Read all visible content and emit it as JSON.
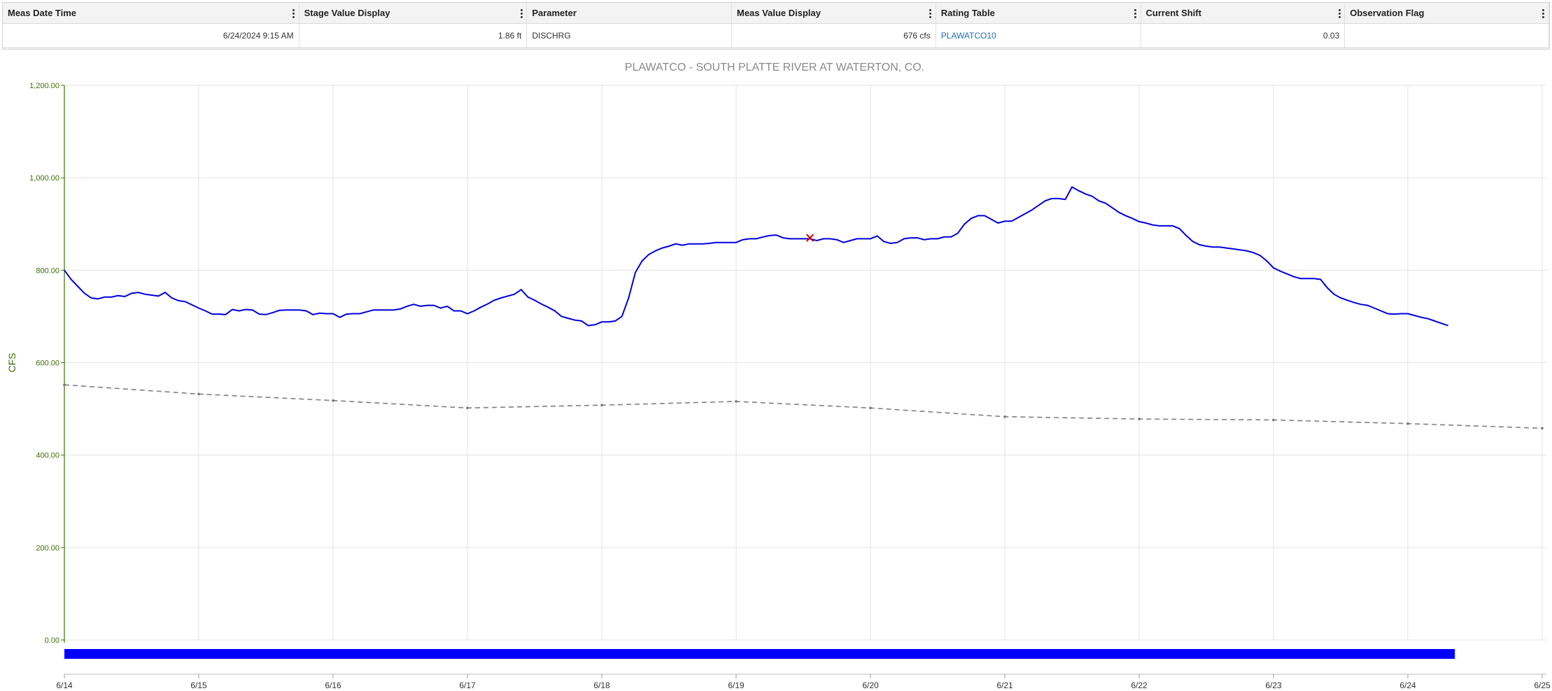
{
  "table": {
    "columns": [
      "Meas Date Time",
      "Stage Value Display",
      "Parameter",
      "Meas Value Display",
      "Rating Table",
      "Current Shift",
      "Observation Flag"
    ],
    "row": {
      "meas_date_time": "6/24/2024 9:15 AM",
      "stage_value": "1.86 ft",
      "parameter": "DISCHRG",
      "meas_value": "676 cfs",
      "rating_table": "PLAWATCO10",
      "current_shift": "0.03",
      "observation_flag": ""
    }
  },
  "chart_data": {
    "type": "line",
    "title": "PLAWATCO - SOUTH PLATTE RIVER AT WATERTON, CO.",
    "ylabel": "CFS",
    "ylim": [
      0,
      1200
    ],
    "yticks": [
      "0.00",
      "200.00",
      "400.00",
      "600.00",
      "800.00",
      "1,000.00",
      "1,200.00"
    ],
    "xlim": [
      0,
      11
    ],
    "xticks": [
      "6/14",
      "6/15",
      "6/16",
      "6/17",
      "6/18",
      "6/19",
      "6/20",
      "6/21",
      "6/22",
      "6/23",
      "6/24",
      "6/25"
    ],
    "grid": true,
    "colors": {
      "discharge": "#0000dd",
      "shifted": "#808080",
      "measurement": "#cc0000",
      "band": "#0000ff",
      "axis": "#3c6e00"
    },
    "series": [
      {
        "style": "solid",
        "x": [
          0,
          0.05,
          0.1,
          0.15,
          0.2,
          0.25,
          0.3,
          0.35,
          0.4,
          0.45,
          0.5,
          0.55,
          0.6,
          0.65,
          0.7,
          0.75,
          0.8,
          0.85,
          0.9,
          0.95,
          1.0,
          1.05,
          1.1,
          1.15,
          1.2,
          1.25,
          1.3,
          1.35,
          1.4,
          1.45,
          1.5,
          1.55,
          1.6,
          1.65,
          1.7,
          1.75,
          1.8,
          1.85,
          1.9,
          1.95,
          2.0,
          2.05,
          2.1,
          2.15,
          2.2,
          2.25,
          2.3,
          2.35,
          2.4,
          2.45,
          2.5,
          2.55,
          2.6,
          2.65,
          2.7,
          2.75,
          2.8,
          2.85,
          2.9,
          2.95,
          3.0,
          3.05,
          3.1,
          3.15,
          3.2,
          3.25,
          3.3,
          3.35,
          3.4,
          3.45,
          3.5,
          3.55,
          3.6,
          3.65,
          3.7,
          3.75,
          3.8,
          3.85,
          3.9,
          3.95,
          4.0,
          4.05,
          4.1,
          4.15,
          4.2,
          4.25,
          4.3,
          4.35,
          4.4,
          4.45,
          4.5,
          4.55,
          4.6,
          4.65,
          4.7,
          4.75,
          4.8,
          4.85,
          4.9,
          4.95,
          5.0,
          5.05,
          5.1,
          5.15,
          5.2,
          5.25,
          5.3,
          5.35,
          5.4,
          5.45,
          5.5,
          5.55,
          5.6,
          5.65,
          5.7,
          5.75,
          5.8,
          5.85,
          5.9,
          5.95,
          6.0,
          6.05,
          6.1,
          6.15,
          6.2,
          6.25,
          6.3,
          6.35,
          6.4,
          6.45,
          6.5,
          6.55,
          6.6,
          6.65,
          6.7,
          6.75,
          6.8,
          6.85,
          6.9,
          6.95,
          7.0,
          7.05,
          7.1,
          7.15,
          7.2,
          7.25,
          7.3,
          7.35,
          7.4,
          7.45,
          7.5,
          7.55,
          7.6,
          7.65,
          7.7,
          7.75,
          7.8,
          7.85,
          7.9,
          7.95,
          8.0,
          8.05,
          8.1,
          8.15,
          8.2,
          8.25,
          8.3,
          8.35,
          8.4,
          8.45,
          8.5,
          8.55,
          8.6,
          8.65,
          8.7,
          8.75,
          8.8,
          8.85,
          8.9,
          8.95,
          9.0,
          9.05,
          9.1,
          9.15,
          9.2,
          9.25,
          9.3,
          9.35,
          9.4,
          9.45,
          9.5,
          9.55,
          9.6,
          9.65,
          9.7,
          9.75,
          9.8,
          9.85,
          9.9,
          9.95,
          10.0,
          10.05,
          10.1,
          10.15,
          10.2,
          10.25,
          10.3
        ],
        "y": [
          800,
          780,
          765,
          750,
          740,
          738,
          742,
          742,
          745,
          743,
          750,
          752,
          748,
          746,
          744,
          752,
          740,
          734,
          732,
          725,
          718,
          712,
          705,
          705,
          704,
          715,
          712,
          715,
          714,
          705,
          704,
          708,
          713,
          714,
          714,
          714,
          712,
          704,
          707,
          706,
          706,
          698,
          705,
          706,
          706,
          710,
          714,
          714,
          714,
          714,
          716,
          722,
          726,
          722,
          724,
          724,
          718,
          722,
          712,
          712,
          706,
          712,
          720,
          727,
          735,
          740,
          744,
          748,
          758,
          742,
          735,
          727,
          720,
          712,
          700,
          696,
          692,
          690,
          680,
          682,
          688,
          688,
          690,
          700,
          740,
          795,
          820,
          834,
          842,
          848,
          852,
          857,
          854,
          857,
          857,
          857,
          858,
          860,
          860,
          860,
          860,
          866,
          868,
          868,
          872,
          875,
          876,
          870,
          868,
          868,
          868,
          868,
          864,
          868,
          868,
          866,
          860,
          864,
          868,
          868,
          868,
          874,
          862,
          858,
          860,
          868,
          870,
          870,
          866,
          868,
          868,
          872,
          872,
          880,
          900,
          912,
          918,
          918,
          910,
          902,
          906,
          906,
          914,
          922,
          930,
          940,
          950,
          955,
          955,
          953,
          980,
          972,
          965,
          960,
          950,
          945,
          935,
          925,
          918,
          912,
          905,
          902,
          898,
          896,
          896,
          896,
          890,
          875,
          862,
          855,
          852,
          850,
          850,
          848,
          846,
          844,
          842,
          838,
          832,
          820,
          805,
          798,
          792,
          786,
          782,
          782,
          782,
          780,
          762,
          748,
          740,
          735,
          730,
          726,
          724,
          718,
          712,
          706,
          705,
          706,
          706,
          702,
          698,
          695,
          690,
          685,
          680
        ]
      },
      {
        "style": "dashed",
        "x": [
          0,
          1,
          2,
          3,
          4,
          5,
          6,
          7,
          8,
          9,
          10,
          11
        ],
        "y": [
          552,
          532,
          518,
          502,
          508,
          516,
          502,
          483,
          478,
          476,
          468,
          458
        ]
      }
    ],
    "measurement_marker": {
      "x": 5.55,
      "y": 870
    },
    "availability_bar": {
      "x_start": 0,
      "x_end": 10.35
    }
  }
}
